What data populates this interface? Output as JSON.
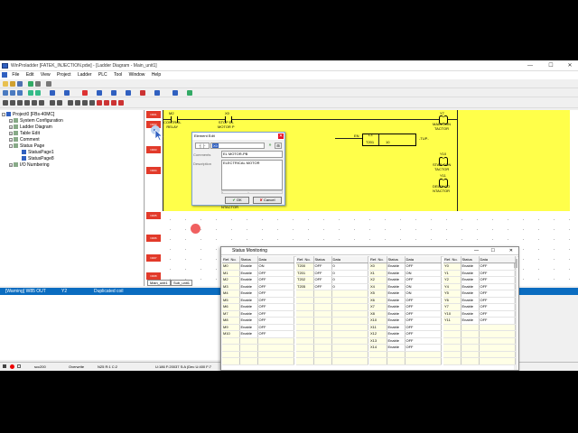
{
  "window": {
    "title": "WinProladder [FATEK_INJECTION.pdw] - [Ladder Diagram - Main_unit1]",
    "controls": {
      "minimize": "—",
      "maximize": "☐",
      "close": "✕"
    }
  },
  "menu": [
    "File",
    "Edit",
    "View",
    "Project",
    "Ladder",
    "PLC",
    "Tool",
    "Window",
    "Help"
  ],
  "tree": {
    "root": "Project0 [FBs-40MC]",
    "items": [
      "System Configuration",
      "Ladder Diagram",
      "Table Edit",
      "Comment",
      "Status Page",
      "I/O Numbering"
    ],
    "status_pages": [
      "StatusPage1",
      "StatusPage8"
    ]
  },
  "ladder": {
    "rung_labels": [
      "N001",
      "N002",
      "N003",
      "N004",
      "N005",
      "N006",
      "N007",
      "N008"
    ],
    "elements": {
      "m2": "M2",
      "control_relay": "CONTROL\nRELAY",
      "x0": "X0",
      "stop": "STOP EL\nMOTOR P",
      "y7": "Y7",
      "main_contactor": "MAIN CON\nTACTOR",
      "en": "EN",
      "timer_label": "L3",
      "timer_num": "T201",
      "timer_val": "10",
      "tup": "-TUP-",
      "y10": "Y10",
      "star_contactor": "STAR CON\nTACTOR",
      "y11": "Y11",
      "delta_contactor": "DELTA CO\nNTACTOR",
      "ntactor": "NTACTOR"
    },
    "sheet_tabs": [
      "Main_unit1",
      "Sub_unit1"
    ]
  },
  "element_edit": {
    "title": "Element Edit",
    "value": "X0",
    "comments_label": "Comments",
    "comments_value": "EL MOTOR-PB",
    "description_label": "Description",
    "description_value": "ELECTRICAL MOTOR",
    "ok": "OK",
    "cancel": "Cancel"
  },
  "output": {
    "warning": "[Warning] W85 OUT",
    "address": "Y2",
    "message": "Duplicated coil"
  },
  "statusbar": {
    "scan": "scc200",
    "mode": "Overwrite",
    "pos": "N25 R:1 C:2",
    "info": "U:186 F:20037 S:A (Dec U:400 F:7"
  },
  "status_monitoring": {
    "title": "Status Monitoring",
    "headers": [
      "Ref. No.",
      "Status",
      "Data"
    ],
    "groups": [
      {
        "rows": [
          [
            "M0",
            "Enable",
            "ON"
          ],
          [
            "M1",
            "Enable",
            "OFF"
          ],
          [
            "M2",
            "Enable",
            "OFF"
          ],
          [
            "M3",
            "Enable",
            "OFF"
          ],
          [
            "M4",
            "Enable",
            "OFF"
          ],
          [
            "M5",
            "Enable",
            "OFF"
          ],
          [
            "M6",
            "Enable",
            "OFF"
          ],
          [
            "M7",
            "Enable",
            "OFF"
          ],
          [
            "M8",
            "Enable",
            "OFF"
          ],
          [
            "M9",
            "Enable",
            "OFF"
          ],
          [
            "M10",
            "Enable",
            "OFF"
          ]
        ]
      },
      {
        "rows": [
          [
            "T200",
            "OFF",
            "0"
          ],
          [
            "T201",
            "OFF",
            "0"
          ],
          [
            "T202",
            "OFF",
            "0"
          ],
          [
            "T205",
            "OFF",
            "0"
          ]
        ]
      },
      {
        "rows": [
          [
            "X0",
            "Enable",
            "OFF"
          ],
          [
            "X1",
            "Enable",
            "ON"
          ],
          [
            "X2",
            "Enable",
            "OFF"
          ],
          [
            "X4",
            "Enable",
            "ON"
          ],
          [
            "X5",
            "Enable",
            "ON"
          ],
          [
            "X6",
            "Enable",
            "OFF"
          ],
          [
            "X7",
            "Enable",
            "OFF"
          ],
          [
            "X8",
            "Enable",
            "OFF"
          ],
          [
            "X10",
            "Enable",
            "OFF"
          ],
          [
            "X11",
            "Enable",
            "OFF"
          ],
          [
            "X12",
            "Enable",
            "OFF"
          ],
          [
            "X13",
            "Enable",
            "OFF"
          ],
          [
            "X14",
            "Enable",
            "OFF"
          ]
        ]
      },
      {
        "rows": [
          [
            "Y0",
            "Enable",
            "OFF"
          ],
          [
            "Y1",
            "Enable",
            "OFF"
          ],
          [
            "Y2",
            "Enable",
            "OFF"
          ],
          [
            "Y4",
            "Enable",
            "OFF"
          ],
          [
            "Y5",
            "Enable",
            "OFF"
          ],
          [
            "Y6",
            "Enable",
            "OFF"
          ],
          [
            "Y7",
            "Enable",
            "OFF"
          ],
          [
            "Y10",
            "Enable",
            "OFF"
          ],
          [
            "Y11",
            "Enable",
            "OFF"
          ]
        ]
      }
    ]
  },
  "colors": {
    "ladder_bg": "#ffff4a",
    "rung_label": "#e23a2a",
    "output_header": "#0a6cc0",
    "cursor_dot": "#f06060"
  }
}
